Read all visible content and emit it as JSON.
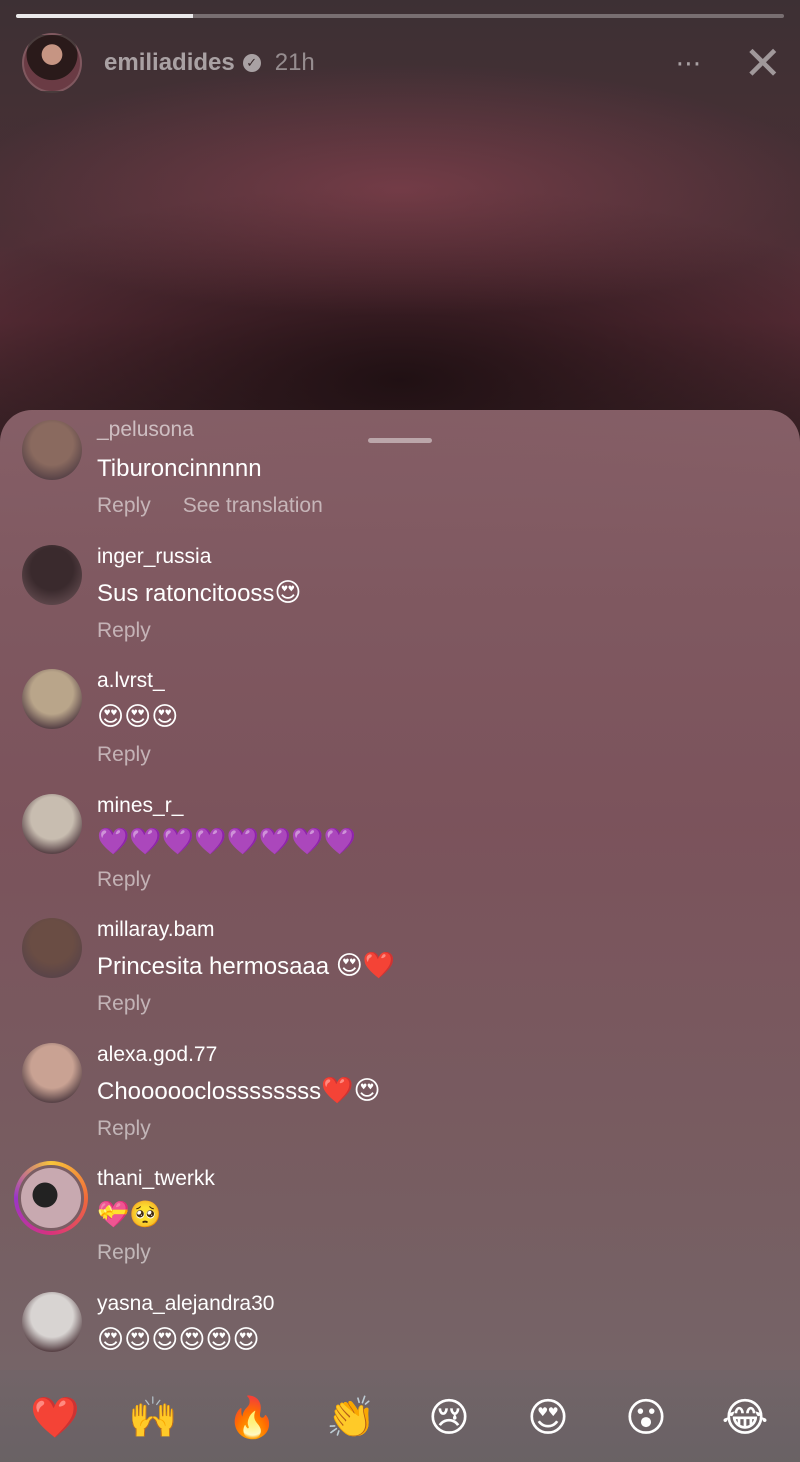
{
  "story": {
    "username": "emiliadides",
    "time": "21h",
    "progress": 0.23,
    "more_icon": "⋯",
    "close_icon": "✕",
    "verified_icon": "✓"
  },
  "comments": [
    {
      "user": "_pelusona",
      "text": "Tiburoncinnnnn",
      "emoji": "",
      "reply": "Reply",
      "translate": "See translation",
      "avatar": "#8a6a5f"
    },
    {
      "user": "inger_russia",
      "text": "Sus ratoncitooss",
      "emoji": "😍",
      "reply": "Reply",
      "translate": "",
      "avatar": "#3a2a2d"
    },
    {
      "user": "a.lvrst_",
      "text": "",
      "emoji": "😍😍😍",
      "reply": "Reply",
      "translate": "",
      "avatar": "#b9a58a"
    },
    {
      "user": "mines_r_",
      "text": "",
      "emoji": "💜💜💜💜💜💜💜💜",
      "reply": "Reply",
      "translate": "",
      "avatar": "#c8bdb0"
    },
    {
      "user": "millaray.bam",
      "text": "Princesita hermosaaa ",
      "emoji": "😍❤️",
      "reply": "Reply",
      "translate": "",
      "avatar": "#6a4d44"
    },
    {
      "user": "alexa.god.77",
      "text": "Choooooclossssssss",
      "emoji": "❤️😍",
      "reply": "Reply",
      "translate": "",
      "avatar": "#c9a293"
    },
    {
      "user": "thani_twerkk",
      "text": "",
      "emoji": "💝🥺",
      "reply": "Reply",
      "translate": "",
      "avatar": "ring"
    },
    {
      "user": "yasna_alejandra30",
      "text": "",
      "emoji": "😍😍😍😍😍😍",
      "reply": "",
      "translate": "",
      "avatar": "#d8d4d2"
    }
  ],
  "reactions": [
    "❤️",
    "🙌",
    "🔥",
    "👏",
    "😢",
    "😍",
    "😮",
    "😂"
  ]
}
